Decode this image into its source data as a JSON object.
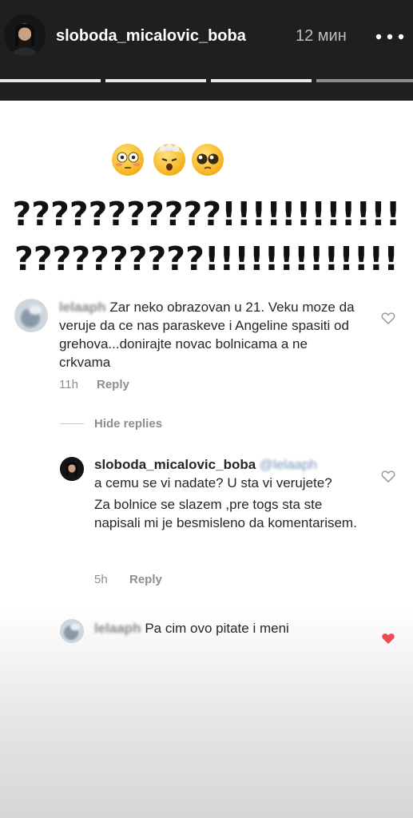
{
  "header": {
    "username": "sloboda_micalovic_boba",
    "time": "12 мин",
    "more_icon": "more-horizontal-icon",
    "segments": [
      {
        "state": "seen"
      },
      {
        "state": "seen"
      },
      {
        "state": "current"
      },
      {
        "state": "upcoming"
      }
    ]
  },
  "story": {
    "emojis": [
      "flushed-face-icon",
      "exploding-head-icon",
      "pleading-face-icon"
    ],
    "line1": "???????????!!!!!!!!!!!!",
    "line2": "??????????!!!!!!!!!!!!!"
  },
  "comments": [
    {
      "username": "lelaaph",
      "text": "Zar neko obrazovan  u 21. Veku moze da veruje da ce nas paraskeve  i Angeline spasiti od grehova...donirajte novac bolnicama a ne crkvama",
      "age": "11h",
      "reply_label": "Reply",
      "hide_replies_label": "Hide replies",
      "liked": false
    },
    {
      "username": "sloboda_micalovic_boba",
      "mention": "@lelaaph",
      "text_part1": "a cemu se vi nadate? U sta vi verujete?",
      "text_part2": "Za bolnice se slazem ,pre togs sta ste napisali mi je besmisleno da komentarisem.",
      "age": "5h",
      "reply_label": "Reply",
      "liked": false
    },
    {
      "username": "lelaaph",
      "text": "Pa cim ovo pitate i meni",
      "liked": true
    }
  ],
  "colors": {
    "header_bg": "#1f1f1f",
    "like_red": "#ed4956",
    "meta_gray": "#8e8e8e"
  }
}
